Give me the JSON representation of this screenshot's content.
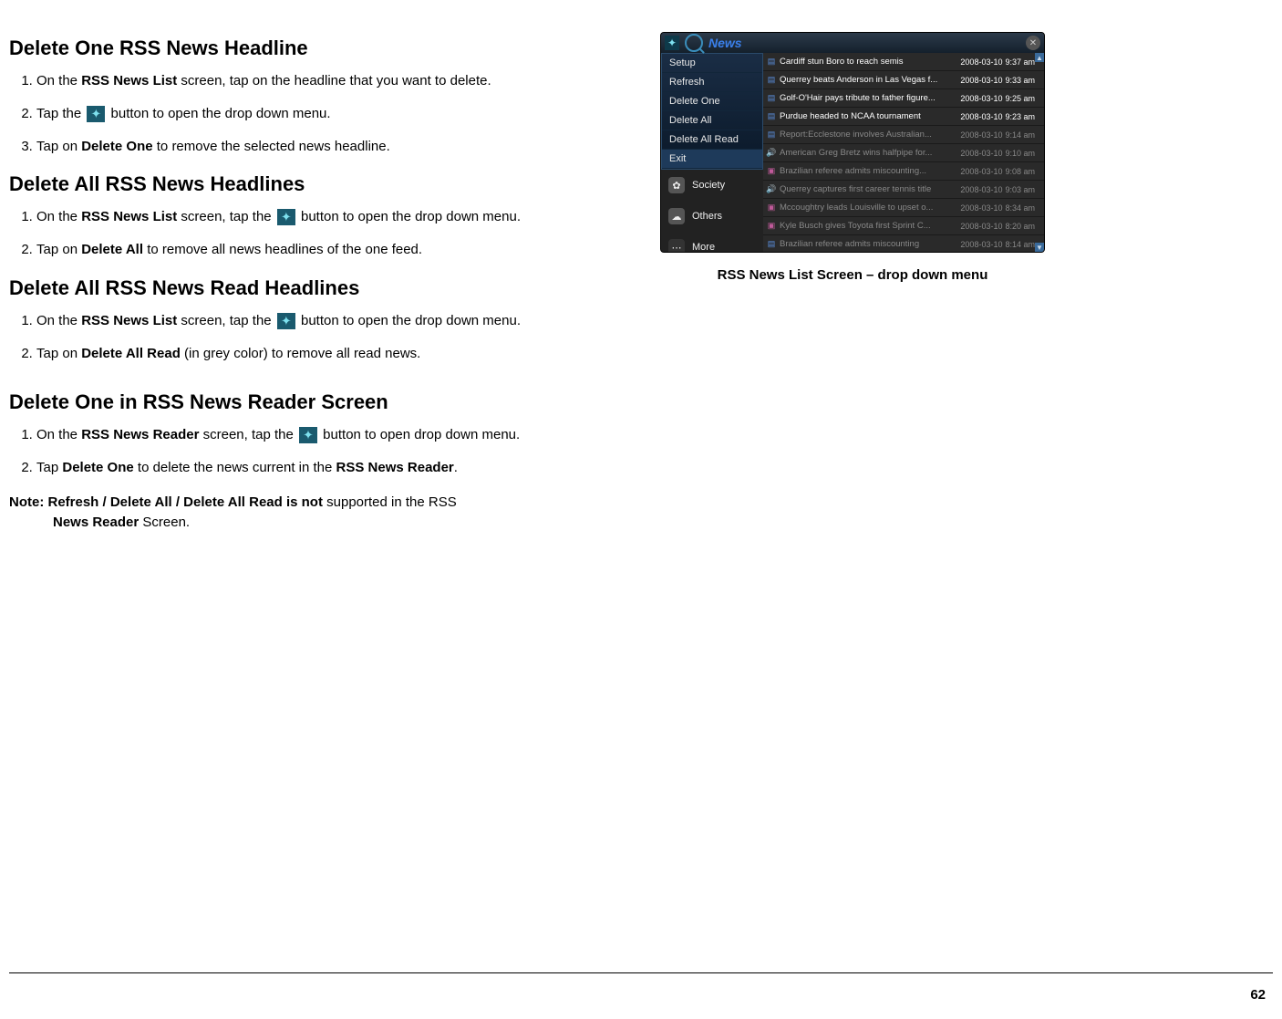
{
  "sections": {
    "s1": {
      "title": "Delete One RSS News Headline"
    },
    "s2": {
      "title": "Delete All RSS News Headlines"
    },
    "s3": {
      "title": "Delete All RSS News Read Headlines"
    },
    "s4": {
      "title": "Delete One in RSS News Reader Screen"
    }
  },
  "steps": {
    "s1_1a": "On the ",
    "s1_1b": "RSS News List",
    "s1_1c": " screen, tap on the headline that you want to delete.",
    "s1_2a": "Tap the ",
    "s1_2b": " button to open the drop down menu.",
    "s1_3a": "Tap on ",
    "s1_3b": "Delete One",
    "s1_3c": " to remove the selected news headline.",
    "s2_1a": "On the ",
    "s2_1b": "RSS News List",
    "s2_1c": " screen, tap the ",
    "s2_1d": " button to open the drop down menu.",
    "s2_2a": "Tap on ",
    "s2_2b": "Delete All",
    "s2_2c": " to remove all news headlines of the one feed.",
    "s3_1a": "On the ",
    "s3_1b": "RSS News List",
    "s3_1c": " screen, tap the ",
    "s3_1d": " button to open the drop down menu.",
    "s3_2a": "Tap on ",
    "s3_2b": "Delete All Read",
    "s3_2c": " (in grey color) to remove all read news.",
    "s4_1a": "On the ",
    "s4_1b": "RSS News Reader",
    "s4_1c": " screen, tap the ",
    "s4_1d": " button to open drop down menu.",
    "s4_2a": "Tap ",
    "s4_2b": "Delete One",
    "s4_2c": " to delete the news current in the ",
    "s4_2d": "RSS News Reader",
    "s4_2e": "."
  },
  "note": {
    "a": "Note: Refresh / Delete All / Delete All Read is not",
    "b": " supported in the RSS ",
    "c": "News Reader",
    "d": " Screen."
  },
  "screenshot": {
    "title": "News",
    "menu": [
      "Setup",
      "Refresh",
      "Delete One",
      "Delete All",
      "Delete All Read",
      "Exit"
    ],
    "side": {
      "society": "Society",
      "others": "Others",
      "more": "More"
    },
    "rows": [
      {
        "t": "Cardiff stun Boro to reach semis",
        "d": "2008-03-10",
        "h": "9:37 am",
        "read": false,
        "ic": "doc"
      },
      {
        "t": "Querrey beats Anderson in Las Vegas f...",
        "d": "2008-03-10",
        "h": "9:33 am",
        "read": false,
        "ic": "doc"
      },
      {
        "t": "Golf-O'Hair pays tribute to father figure...",
        "d": "2008-03-10",
        "h": "9:25 am",
        "read": false,
        "ic": "doc"
      },
      {
        "t": "Purdue headed to NCAA tournament",
        "d": "2008-03-10",
        "h": "9:23 am",
        "read": false,
        "ic": "doc"
      },
      {
        "t": "Report:Ecclestone involves Australian...",
        "d": "2008-03-10",
        "h": "9:14 am",
        "read": true,
        "ic": "doc"
      },
      {
        "t": "American Greg Bretz wins halfpipe for...",
        "d": "2008-03-10",
        "h": "9:10 am",
        "read": true,
        "ic": "snd"
      },
      {
        "t": "Brazilian referee admits miscounting...",
        "d": "2008-03-10",
        "h": "9:08 am",
        "read": true,
        "ic": "pic"
      },
      {
        "t": "Querrey captures first career tennis title",
        "d": "2008-03-10",
        "h": "9:03 am",
        "read": true,
        "ic": "snd"
      },
      {
        "t": "Mccoughtry leads Louisville to upset o...",
        "d": "2008-03-10",
        "h": "8:34 am",
        "read": true,
        "ic": "pic"
      },
      {
        "t": "Kyle Busch gives Toyota first Sprint C...",
        "d": "2008-03-10",
        "h": "8:20 am",
        "read": true,
        "ic": "pic"
      },
      {
        "t": "Brazilian referee admits miscounting",
        "d": "2008-03-10",
        "h": "8:14 am",
        "read": true,
        "ic": "doc"
      }
    ],
    "caption": "RSS News List Screen – drop down menu"
  },
  "page_number": "62"
}
